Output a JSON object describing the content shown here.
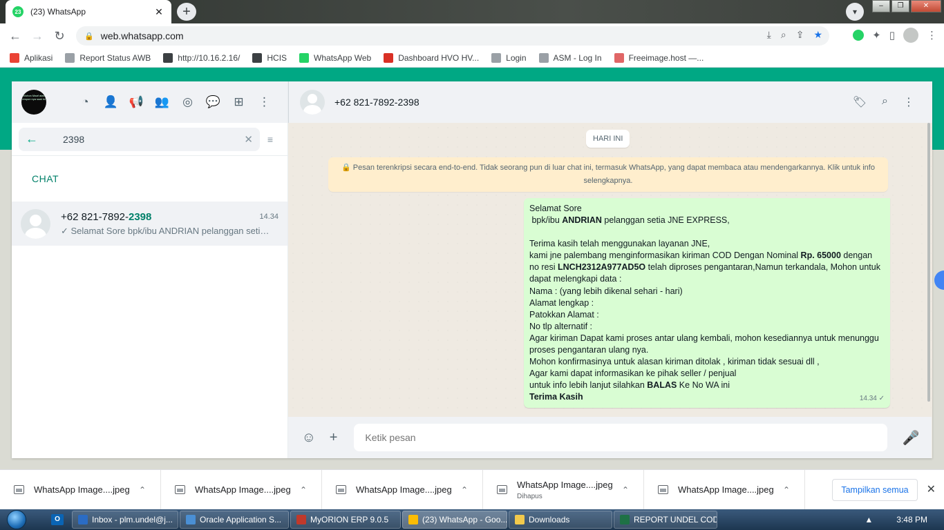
{
  "browser": {
    "tab_title": "(23) WhatsApp",
    "tab_badge": "23",
    "url": "web.whatsapp.com",
    "bookmarks": [
      {
        "label": "Aplikasi",
        "color": "#ea4335"
      },
      {
        "label": "Report Status AWB",
        "color": "#9aa0a6"
      },
      {
        "label": "http://10.16.2.16/",
        "color": "#3c4043"
      },
      {
        "label": "HCIS",
        "color": "#3c4043"
      },
      {
        "label": "WhatsApp Web",
        "color": "#25d366"
      },
      {
        "label": "Dashboard HVO HV...",
        "color": "#d93025"
      },
      {
        "label": "Login",
        "color": "#9aa0a6"
      },
      {
        "label": "ASM - Log In",
        "color": "#9aa0a6"
      },
      {
        "label": "Freeimage.host —...",
        "color": "#e06666"
      }
    ]
  },
  "whatsapp": {
    "me_avatar_text": "Mohon Maaf atas respon nya saat ini",
    "search_value": "2398",
    "section_label": "CHAT",
    "chat": {
      "name_prefix": "+62 821-7892-",
      "name_match": "2398",
      "time": "14.34",
      "preview": "✓ Selamat Sore  bpk/ibu ANDRIAN pelanggan setia J..."
    },
    "conversation": {
      "title": "+62 821-7892-2398",
      "date_pill": "HARI INI",
      "encryption_notice": "🔒 Pesan terenkripsi secara end-to-end. Tidak seorang pun di luar chat ini, termasuk WhatsApp, yang dapat membaca atau mendengarkannya. Klik untuk info selengkapnya.",
      "message": {
        "line1": "Selamat Sore",
        "line2_pre": " bpk/ibu ",
        "line2_bold": "ANDRIAN",
        "line2_post": " pelanggan setia JNE EXPRESS,",
        "line3": "Terima kasih telah menggunakan layanan JNE,",
        "line4_pre": "kami jne palembang menginformasikan kiriman  COD Dengan Nominal ",
        "line4_bold": "Rp. 65000",
        "line4_post": " dengan no resi ",
        "line4_bold2": "LNCH2312A977AD5O",
        "line4_post2": " telah diproses pengantaran,Namun terkandala, Mohon untuk dapat melengkapi data :",
        "line5": "Nama : (yang lebih dikenal sehari - hari)",
        "line6": "Alamat  lengkap :",
        "line7": "Patokkan Alamat :",
        "line8": "No tlp alternatif :",
        "line9": "Agar kiriman Dapat kami proses antar ulang kembali, mohon kesediannya untuk menunggu proses pengantaran ulang nya.",
        "line10": "Mohon konfirmasinya untuk alasan kiriman ditolak , kiriman tidak sesuai dll ,",
        "line11": "Agar kami dapat informasikan ke pihak seller / penjual",
        "line12_pre": "untuk info lebih lanjut silahkan ",
        "line12_bold": "BALAS",
        "line12_post": " Ke No WA ini",
        "line13": "Terima Kasih",
        "time": "14.34 ✓"
      },
      "composer_placeholder": "Ketik pesan"
    }
  },
  "downloads": {
    "items": [
      {
        "name": "WhatsApp Image....jpeg",
        "sub": ""
      },
      {
        "name": "WhatsApp Image....jpeg",
        "sub": ""
      },
      {
        "name": "WhatsApp Image....jpeg",
        "sub": ""
      },
      {
        "name": "WhatsApp Image....jpeg",
        "sub": "Dihapus"
      },
      {
        "name": "WhatsApp Image....jpeg",
        "sub": ""
      }
    ],
    "show_all": "Tampilkan semua"
  },
  "taskbar": {
    "items": [
      {
        "label": "Inbox - plm.undel@j...",
        "color": "#2b6cc4"
      },
      {
        "label": "Oracle Application S...",
        "color": "#4a8fd4"
      },
      {
        "label": "MyORION ERP 9.0.5",
        "color": "#c0392b"
      },
      {
        "label": "(23) WhatsApp - Goo...",
        "color": "#fbbc05"
      },
      {
        "label": "Downloads",
        "color": "#f2c94c"
      },
      {
        "label": "REPORT UNDEL COD...",
        "color": "#1e7145"
      }
    ],
    "clock": "3:48 PM"
  }
}
